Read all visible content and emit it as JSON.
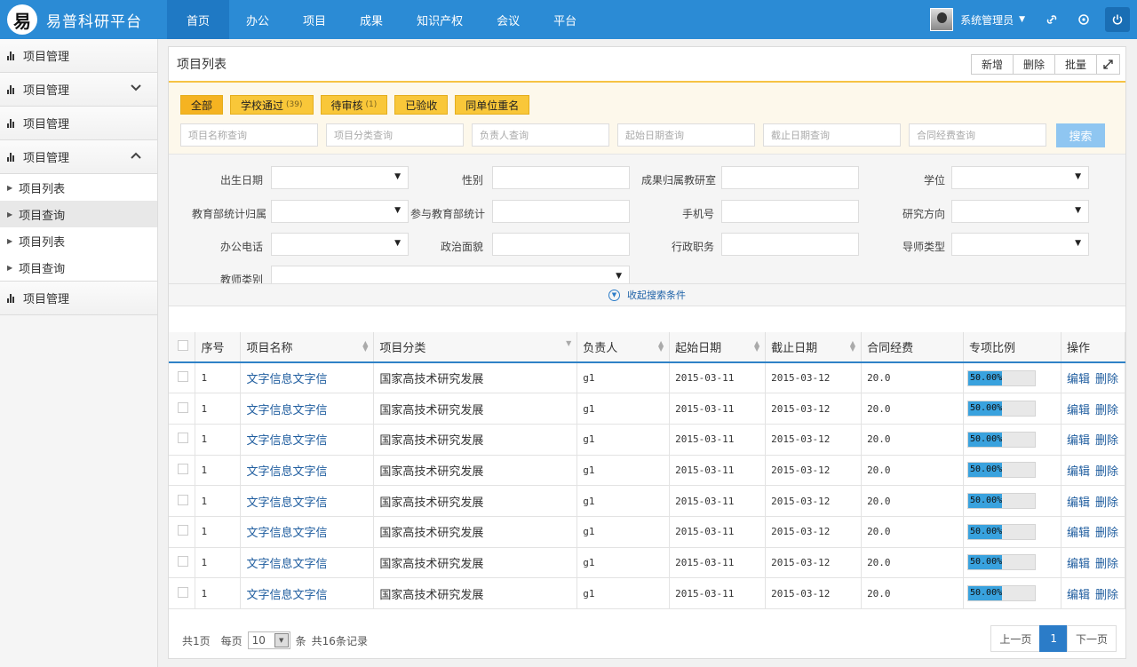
{
  "brand": {
    "logo_char": "易",
    "title": "易普科研平台"
  },
  "nav": [
    "首页",
    "办公",
    "项目",
    "成果",
    "知识产权",
    "会议",
    "平台"
  ],
  "user": {
    "name": "系统管理员"
  },
  "sidebar": {
    "groups": [
      "项目管理",
      "项目管理",
      "项目管理",
      "项目管理",
      "项目管理"
    ],
    "subitems": [
      "项目列表",
      "项目查询",
      "项目列表",
      "项目查询"
    ]
  },
  "panel": {
    "title": "项目列表",
    "buttons": [
      "新增",
      "删除",
      "批量"
    ]
  },
  "tags": [
    {
      "label": "全部",
      "count": ""
    },
    {
      "label": "学校通过",
      "count": "(39)"
    },
    {
      "label": "待审核",
      "count": "(1)"
    },
    {
      "label": "已验收",
      "count": ""
    },
    {
      "label": "同单位重名",
      "count": ""
    }
  ],
  "queries": [
    "项目名称查询",
    "项目分类查询",
    "负责人查询",
    "起始日期查询",
    "截止日期查询",
    "合同经费查询"
  ],
  "search_label": "搜索",
  "adv_labels": [
    "出生日期",
    "性别",
    "成果归属教研室",
    "学位",
    "教育部统计归属",
    "参与教育部统计",
    "手机号",
    "研究方向",
    "办公电话",
    "政治面貌",
    "行政职务",
    "导师类型",
    "教师类别"
  ],
  "collapse_label": "收起搜索条件",
  "table": {
    "headers": [
      "序号",
      "项目名称",
      "项目分类",
      "负责人",
      "起始日期",
      "截止日期",
      "合同经费",
      "专项比例",
      "操作"
    ],
    "rows": [
      [
        "1",
        "文字信息文字信",
        "国家高技术研究发展",
        "g1",
        "2015-03-11",
        "2015-03-12",
        "20.0",
        "50.00%"
      ],
      [
        "1",
        "文字信息文字信",
        "国家高技术研究发展",
        "g1",
        "2015-03-11",
        "2015-03-12",
        "20.0",
        "50.00%"
      ],
      [
        "1",
        "文字信息文字信",
        "国家高技术研究发展",
        "g1",
        "2015-03-11",
        "2015-03-12",
        "20.0",
        "50.00%"
      ],
      [
        "1",
        "文字信息文字信",
        "国家高技术研究发展",
        "g1",
        "2015-03-11",
        "2015-03-12",
        "20.0",
        "50.00%"
      ],
      [
        "1",
        "文字信息文字信",
        "国家高技术研究发展",
        "g1",
        "2015-03-11",
        "2015-03-12",
        "20.0",
        "50.00%"
      ],
      [
        "1",
        "文字信息文字信",
        "国家高技术研究发展",
        "g1",
        "2015-03-11",
        "2015-03-12",
        "20.0",
        "50.00%"
      ],
      [
        "1",
        "文字信息文字信",
        "国家高技术研究发展",
        "g1",
        "2015-03-11",
        "2015-03-12",
        "20.0",
        "50.00%"
      ],
      [
        "1",
        "文字信息文字信",
        "国家高技术研究发展",
        "g1",
        "2015-03-11",
        "2015-03-12",
        "20.0",
        "50.00%"
      ]
    ],
    "edit_label": "编辑",
    "delete_label": "删除",
    "progress_fraction": 0.5
  },
  "footer": {
    "pages_text": "共1页",
    "per_page_label": "每页",
    "per_page_value": "10",
    "unit_label": "条",
    "total_text": "共16条记录",
    "prev": "上一页",
    "current": "1",
    "next": "下一页"
  },
  "colors": {
    "header": "#2b8bd5",
    "tag": "#f9c739",
    "accent": "#2b7cc8",
    "progress": "#39a2de"
  }
}
